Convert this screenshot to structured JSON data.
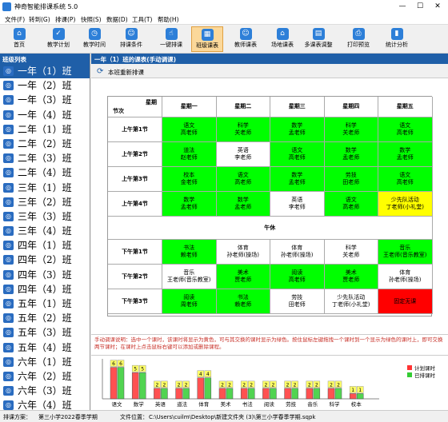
{
  "app": {
    "title": "神奇智能排课系统 5.0",
    "min": "—",
    "max": "☐",
    "close": "✕"
  },
  "menu": [
    "文件(F)",
    "转到(G)",
    "排课(P)",
    "快照(S)",
    "数据(D)",
    "工具(T)",
    "帮助(H)"
  ],
  "toolbar": [
    {
      "label": "首页",
      "icon": "home-icon",
      "glyph": "⌂"
    },
    {
      "label": "教学计划",
      "icon": "clipboard-check-icon",
      "glyph": "✓"
    },
    {
      "label": "教学时间",
      "icon": "clock-icon",
      "glyph": "◷"
    },
    {
      "label": "排课条件",
      "icon": "users-icon",
      "glyph": "☺"
    },
    {
      "label": "一键排课",
      "icon": "hand-click-icon",
      "glyph": "☝"
    },
    {
      "label": "班级课表",
      "icon": "calendar-grid-icon",
      "glyph": "▦"
    },
    {
      "label": "教师课表",
      "icon": "teacher-icon",
      "glyph": "☺"
    },
    {
      "label": "场地课表",
      "icon": "building-icon",
      "glyph": "⌂"
    },
    {
      "label": "多课表调整",
      "icon": "multi-table-icon",
      "glyph": "▤"
    },
    {
      "label": "打印预览",
      "icon": "printer-icon",
      "glyph": "⎙"
    },
    {
      "label": "统计分析",
      "icon": "bar-chart-icon",
      "glyph": "▮"
    }
  ],
  "left": {
    "header": "班级列表",
    "classes": [
      "一年（1）班",
      "一年（2）班",
      "一年（3）班",
      "一年（4）班",
      "二年（1）班",
      "二年（2）班",
      "二年（3）班",
      "二年（4）班",
      "三年（1）班",
      "三年（2）班",
      "三年（3）班",
      "三年（4）班",
      "四年（1）班",
      "四年（2）班",
      "四年（3）班",
      "四年（4）班",
      "五年（1）班",
      "五年（2）班",
      "五年（3）班",
      "五年（4）班",
      "六年（1）班",
      "六年（2）班",
      "六年（3）班",
      "六年（4）班"
    ]
  },
  "main": {
    "header": "一年（1）班的课表(手动调课)",
    "rearrange": "本班重新排课",
    "corner_top": "星期",
    "corner_bottom": "节次",
    "days": [
      "星期一",
      "星期二",
      "星期三",
      "星期四",
      "星期五"
    ],
    "break_label": "午休",
    "colors": {
      "green": "#00ff00",
      "white": "#ffffff",
      "yellow": "#ffff00",
      "red": "#ff0000"
    },
    "rows": [
      {
        "label": "上午第1节",
        "cells": [
          [
            "语文",
            "高老师",
            "green"
          ],
          [
            "科学",
            "关老师",
            "green"
          ],
          [
            "数学",
            "孟老师",
            "green"
          ],
          [
            "科学",
            "关老师",
            "green"
          ],
          [
            "语文",
            "高老师",
            "green"
          ]
        ]
      },
      {
        "label": "上午第2节",
        "cells": [
          [
            "道法",
            "赵老师",
            "green"
          ],
          [
            "英语",
            "李老师",
            "white"
          ],
          [
            "语文",
            "高老师",
            "green"
          ],
          [
            "数学",
            "孟老师",
            "green"
          ],
          [
            "数学",
            "孟老师",
            "green"
          ]
        ]
      },
      {
        "label": "上午第3节",
        "cells": [
          [
            "校本",
            "金老师",
            "green"
          ],
          [
            "语文",
            "高老师",
            "green"
          ],
          [
            "数学",
            "孟老师",
            "green"
          ],
          [
            "劳技",
            "田老师",
            "green"
          ],
          [
            "语文",
            "高老师",
            "green"
          ]
        ]
      },
      {
        "label": "上午第4节",
        "cells": [
          [
            "数学",
            "孟老师",
            "green"
          ],
          [
            "数学",
            "孟老师",
            "green"
          ],
          [
            "英语",
            "李老师",
            "white"
          ],
          [
            "语文",
            "高老师",
            "green"
          ],
          [
            "少先队活动",
            "丁老师(小礼堂)",
            "yellow"
          ]
        ]
      },
      {
        "label": "下午第1节",
        "cells": [
          [
            "书法",
            "赖老师",
            "green"
          ],
          [
            "体育",
            "孙老师(操场)",
            "white"
          ],
          [
            "体育",
            "孙老师(操场)",
            "white"
          ],
          [
            "科学",
            "关老师",
            "white"
          ],
          [
            "音乐",
            "王老师(音乐教室)",
            "green"
          ]
        ]
      },
      {
        "label": "下午第2节",
        "cells": [
          [
            "音乐",
            "王老师(音乐教室)",
            "white"
          ],
          [
            "美术",
            "贾老师",
            "green"
          ],
          [
            "阅读",
            "高老师",
            "green"
          ],
          [
            "美术",
            "贾老师",
            "green"
          ],
          [
            "体育",
            "孙老师(操场)",
            "white"
          ]
        ]
      },
      {
        "label": "下午第3节",
        "cells": [
          [
            "阅读",
            "周老师",
            "green"
          ],
          [
            "书法",
            "赖老师",
            "green"
          ],
          [
            "劳技",
            "田老师",
            "white"
          ],
          [
            "少先队活动",
            "丁老师(小礼堂)",
            "white"
          ],
          [
            "固定无课",
            "",
            "red"
          ]
        ]
      }
    ]
  },
  "hint": "手动调课说明：选中一个课时，该课时将显示为黄色，可与其交换的课时显示为绿色。按住鼠标左键拖拽一个课时到一个显示为绿色的课时上，即可交换两节课时；在课时上点击鼠标右键可以添加或删除课程。",
  "chart_data": {
    "type": "bar",
    "categories": [
      "语文",
      "数学",
      "英语",
      "道法",
      "体育",
      "美术",
      "书法",
      "阅读",
      "劳技",
      "音乐",
      "科学",
      "校本"
    ],
    "series": [
      {
        "name": "计划课时",
        "values": [
          6,
          5,
          2,
          2,
          4,
          2,
          2,
          2,
          2,
          2,
          2,
          1
        ],
        "color": "#ff3333"
      },
      {
        "name": "已排课时",
        "values": [
          6,
          5,
          2,
          2,
          4,
          2,
          2,
          2,
          2,
          2,
          2,
          1
        ],
        "color": "#33cc33"
      }
    ],
    "ylim": [
      0,
      7
    ]
  },
  "status": {
    "label": "排课方案：",
    "plan": "第三小学2022春季学期",
    "file_label": "文件位置：",
    "path": "C:\\Users\\cuilm\\Desktop\\新建文件夹 (3)\\第三小学春季学期.sqpk"
  }
}
